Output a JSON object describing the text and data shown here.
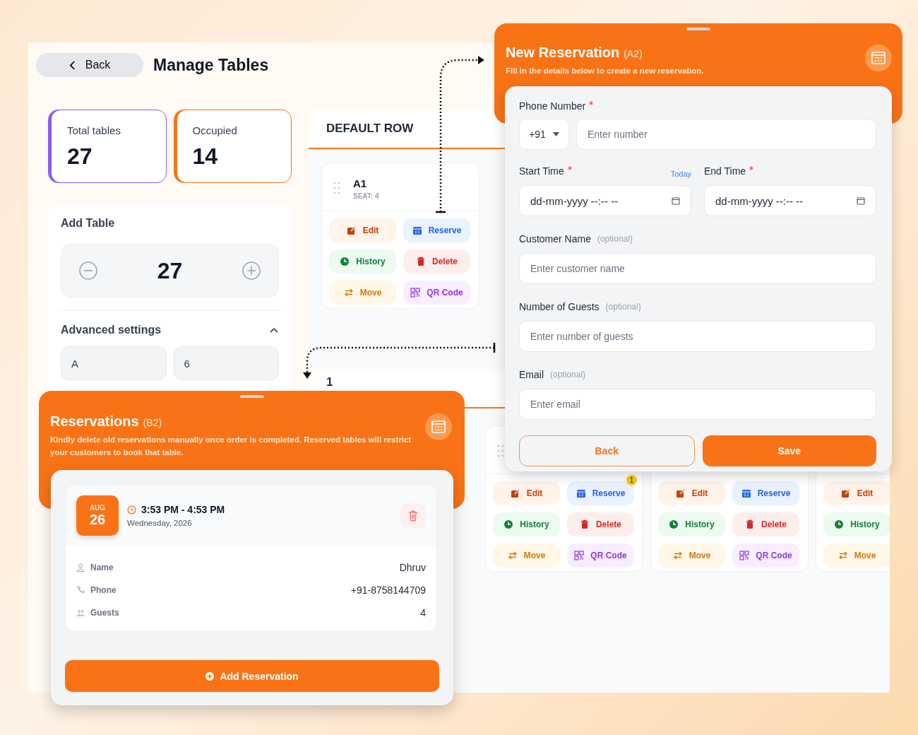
{
  "header": {
    "back_label": "Back",
    "title": "Manage Tables"
  },
  "stats": [
    {
      "label": "Total tables",
      "value": "27",
      "color": "#8b5cf6"
    },
    {
      "label": "Occupied",
      "value": "14",
      "color": "#f97316"
    }
  ],
  "add_table": {
    "title": "Add Table",
    "count": "27",
    "advanced": {
      "title": "Advanced settings",
      "expanded": true,
      "fields": [
        {
          "value": "A"
        },
        {
          "value": "6"
        }
      ]
    }
  },
  "rows": [
    {
      "title": "DEFAULT ROW",
      "tables": [
        {
          "name": "A1",
          "seats": "SEAT: 4",
          "actions": [
            {
              "kind": "edit",
              "label": "Edit"
            },
            {
              "kind": "history",
              "label": "History"
            },
            {
              "kind": "move",
              "label": "Move"
            },
            {
              "kind": "reserve",
              "label": "Reserve"
            },
            {
              "kind": "delete",
              "label": "Delete"
            },
            {
              "kind": "qr",
              "label": "QR Code"
            }
          ]
        }
      ]
    },
    {
      "title": "1",
      "tables": [
        {
          "actions": [
            {
              "kind": "edit",
              "label": "Edit"
            },
            {
              "kind": "history",
              "label": "History"
            },
            {
              "kind": "move",
              "label": "Move"
            },
            {
              "kind": "reserve",
              "label": "Reserve",
              "badge": "1"
            },
            {
              "kind": "delete",
              "label": "Delete"
            },
            {
              "kind": "qr",
              "label": "QR Code"
            }
          ]
        },
        {
          "actions": [
            {
              "kind": "edit",
              "label": "Edit"
            },
            {
              "kind": "history",
              "label": "History"
            },
            {
              "kind": "move",
              "label": "Move"
            },
            {
              "kind": "reserve",
              "label": "Reserve"
            },
            {
              "kind": "delete",
              "label": "Delete"
            },
            {
              "kind": "qr",
              "label": "QR Code"
            }
          ]
        },
        {
          "actions": [
            {
              "kind": "edit",
              "label": "Edit"
            },
            {
              "kind": "history",
              "label": "History"
            },
            {
              "kind": "move",
              "label": "Move"
            }
          ]
        }
      ]
    }
  ],
  "new_reservation": {
    "title": "New Reservation",
    "tag": "(A2)",
    "subtitle": "Fill in the details below to create a new reservation.",
    "phone": {
      "label": "Phone Number",
      "required": true,
      "country_code": "+91",
      "placeholder": "Enter number"
    },
    "times": [
      {
        "label": "Start Time",
        "required": true,
        "link": "Today",
        "value": "dd-mm-yyyy --:-- --"
      },
      {
        "label": "End Time",
        "required": true,
        "value": "dd-mm-yyyy --:-- --"
      }
    ],
    "fields": [
      {
        "label": "Customer Name",
        "note": "(optional)",
        "placeholder": "Enter customer name"
      },
      {
        "label": "Number of Guests",
        "note": "(optional)",
        "placeholder": "Enter number of guests"
      },
      {
        "label": "Email",
        "note": "(optional)",
        "placeholder": "Enter email"
      }
    ],
    "buttons": [
      {
        "label": "Back",
        "kind": "secondary"
      },
      {
        "label": "Save",
        "kind": "primary"
      }
    ]
  },
  "reservations": {
    "title": "Reservations",
    "tag": "(B2)",
    "notice": "Kindly delete old reservations manually once order is completed. Reserved tables will restrict your customers to book that table.",
    "entries": [
      {
        "month": "AUG",
        "day": "26",
        "time": "3:53 PM - 4:53 PM",
        "date": "Wednesday, 2026",
        "details": [
          {
            "kind": "name",
            "label": "Name",
            "value": "Dhruv"
          },
          {
            "kind": "phone",
            "label": "Phone",
            "value": "+91-8758144709"
          },
          {
            "kind": "guests",
            "label": "Guests",
            "value": "4"
          }
        ]
      }
    ],
    "add_button": "Add Reservation"
  }
}
